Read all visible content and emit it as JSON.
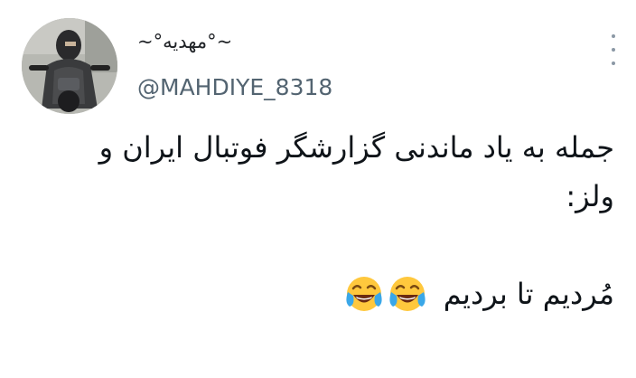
{
  "user": {
    "display_name": "~°مهدیه°~",
    "handle": "@MAHDIYE_8318",
    "avatar_icon": "user-avatar"
  },
  "more_icon": "more-vertical-icon",
  "tweet": {
    "line1": "جمله به یاد ماندنی گزارشگر فوتبال ایران و",
    "line2": "ولز:",
    "line3": "مُردیم تا بردیم",
    "emoji": [
      "face-with-tears-of-joy-icon",
      "face-with-tears-of-joy-icon"
    ]
  },
  "colors": {
    "text": "#0f1419",
    "handle": "#536471",
    "emoji_face": "#ffc83d",
    "tears": "#3aa7e8"
  }
}
